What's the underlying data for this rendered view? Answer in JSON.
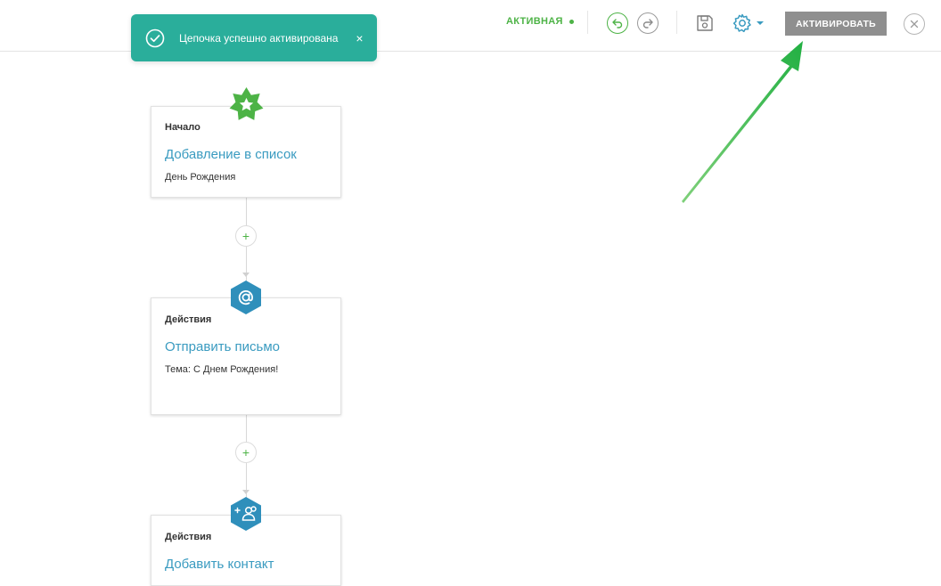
{
  "header": {
    "status_label": "АКТИВНАЯ",
    "activate_label": "АКТИВИРОВАТЬ"
  },
  "toast": {
    "message": "Цепочка успешно активирована",
    "close_glyph": "×"
  },
  "flow": {
    "add_glyph": "+",
    "nodes": [
      {
        "type": "Начало",
        "title": "Добавление в список",
        "subtitle": "День Рождения",
        "icon": "star-icon"
      },
      {
        "type": "Действия",
        "title": "Отправить письмо",
        "subtitle": "Тема: С Днем Рождения!",
        "icon": "at-sign-icon"
      },
      {
        "type": "Действия",
        "title": "Добавить контакт",
        "subtitle": "",
        "icon": "add-contact-icon"
      }
    ]
  },
  "colors": {
    "accent_green": "#4db346",
    "toast_teal": "#2aae9b",
    "link_blue": "#3a9bc0",
    "node_hex_blue": "#2f8fbb",
    "annotation_arrow": "#2db34a",
    "activate_button_gray": "#8f8f8f"
  }
}
